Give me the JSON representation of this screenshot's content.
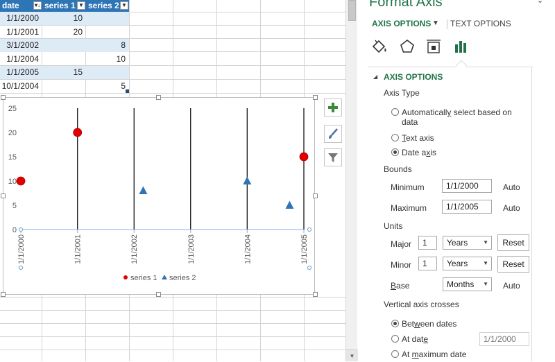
{
  "sheet": {
    "headers": [
      "date",
      "series 1",
      "series 2"
    ],
    "rows": [
      {
        "date": "1/1/2000",
        "s1": "10",
        "s2": ""
      },
      {
        "date": "1/1/2001",
        "s1": "20",
        "s2": ""
      },
      {
        "date": "3/1/2002",
        "s1": "",
        "s2": "8"
      },
      {
        "date": "1/1/2004",
        "s1": "",
        "s2": "10"
      },
      {
        "date": "1/1/2005",
        "s1": "15",
        "s2": ""
      },
      {
        "date": "10/1/2004",
        "s1": "",
        "s2": "5"
      }
    ]
  },
  "chart_side_buttons": {
    "add": "chart-elements-plus-icon",
    "style": "chart-styles-brush-icon",
    "filter": "chart-filters-funnel-icon"
  },
  "chart_data": {
    "type": "scatter",
    "x_axis_type": "date",
    "categories": [
      "1/1/2000",
      "1/1/2001",
      "1/1/2002",
      "1/1/2003",
      "1/1/2004",
      "1/1/2005"
    ],
    "y_ticks": [
      "0",
      "5",
      "10",
      "15",
      "20",
      "25"
    ],
    "ylim": [
      0,
      25
    ],
    "x_range": [
      "1/1/2000",
      "1/1/2005"
    ],
    "vertical_gridlines": true,
    "legend_position": "bottom",
    "series": [
      {
        "name": "series 1",
        "marker": "circle",
        "color": "#e00000",
        "points": [
          {
            "x": "1/1/2000",
            "y": 10
          },
          {
            "x": "1/1/2001",
            "y": 20
          },
          {
            "x": "1/1/2005",
            "y": 15
          }
        ]
      },
      {
        "name": "series 2",
        "marker": "triangle",
        "color": "#2e75b6",
        "points": [
          {
            "x": "3/1/2002",
            "y": 8
          },
          {
            "x": "1/1/2004",
            "y": 10
          },
          {
            "x": "10/1/2004",
            "y": 5
          }
        ]
      }
    ]
  },
  "pane": {
    "title": "Format Axis",
    "tabs": {
      "axis_options": "AXIS OPTIONS",
      "text_options": "TEXT OPTIONS"
    },
    "section": "AXIS OPTIONS",
    "axis_type": {
      "label": "Axis Type",
      "auto_pre": "Automaticall",
      "auto_u": "y",
      "auto_post": " select based on",
      "auto_line2": "data",
      "text_u": "T",
      "text_post": "ext axis",
      "date_pre": "Date a",
      "date_u": "x",
      "date_post": "is",
      "selected": "date"
    },
    "bounds": {
      "label": "Bounds",
      "min_label": "Minimum",
      "min_value": "1/1/2000",
      "min_auto": "Auto",
      "max_label": "Maximum",
      "max_value": "1/1/2005",
      "max_auto": "Auto"
    },
    "units": {
      "label": "Units",
      "major_label": "Major",
      "major_value": "1",
      "major_unit": "Years",
      "major_reset": "Reset",
      "minor_label": "Minor",
      "minor_value": "1",
      "minor_unit": "Years",
      "minor_reset": "Reset",
      "base_u": "B",
      "base_post": "ase",
      "base_value": "Months",
      "base_auto": "Auto"
    },
    "crosses": {
      "label": "Vertical axis crosses",
      "between_pre": "Bet",
      "between_u": "w",
      "between_post": "een dates",
      "atdate_pre": "At dat",
      "atdate_u": "e",
      "atdate_value": "1/1/2000",
      "atmax_pre": "At ",
      "atmax_u": "m",
      "atmax_post": "aximum date",
      "selected": "between"
    }
  }
}
